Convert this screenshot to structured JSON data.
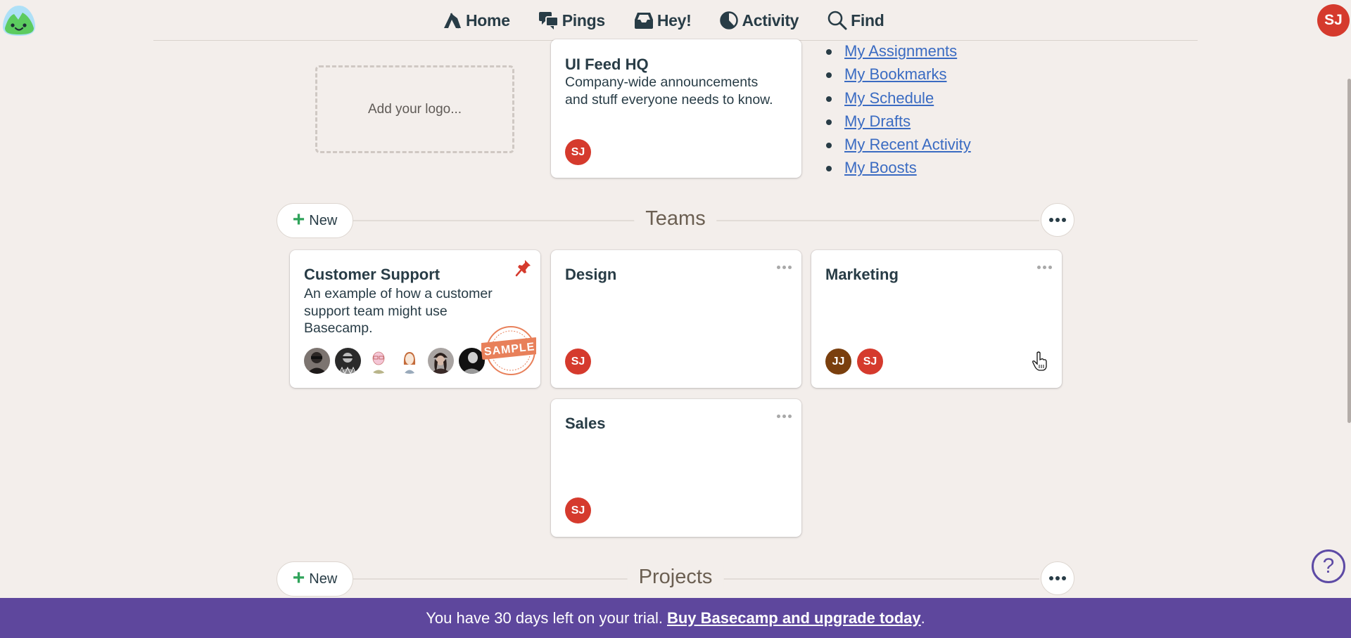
{
  "nav": {
    "items": [
      {
        "label": "Home",
        "icon": "home-icon"
      },
      {
        "label": "Pings",
        "icon": "pings-icon"
      },
      {
        "label": "Hey!",
        "icon": "inbox-icon"
      },
      {
        "label": "Activity",
        "icon": "activity-icon"
      },
      {
        "label": "Find",
        "icon": "search-icon"
      }
    ],
    "user_initials": "SJ"
  },
  "hq": {
    "logo_placeholder": "Add your logo...",
    "card": {
      "title": "UI Feed HQ",
      "description": "Company-wide announcements and stuff everyone needs to know.",
      "members": [
        "SJ"
      ]
    }
  },
  "my_links": [
    "My Assignments",
    "My Bookmarks",
    "My Schedule",
    "My Drafts",
    "My Recent Activity",
    "My Boosts"
  ],
  "teams": {
    "title": "Teams",
    "new_label": "New",
    "cards": [
      {
        "title": "Customer Support",
        "description": "An example of how a customer support team might use Basecamp.",
        "pinned": true,
        "badge": "SAMPLE",
        "member_count": 6
      },
      {
        "title": "Design",
        "members": [
          "SJ"
        ]
      },
      {
        "title": "Marketing",
        "members": [
          "JJ",
          "SJ"
        ]
      },
      {
        "title": "Sales",
        "members": [
          "SJ"
        ]
      }
    ]
  },
  "projects": {
    "title": "Projects",
    "new_label": "New"
  },
  "trial": {
    "message": "You have 30 days left on your trial.",
    "link": "Buy Basecamp and upgrade today",
    "suffix": "."
  },
  "help": {
    "label": "?"
  },
  "colors": {
    "accent_purple": "#5e479d",
    "avatar_red": "#d53a2d",
    "avatar_brown": "#7a3f0e",
    "link_blue": "#3a6bc2",
    "plus_green": "#2fa35a"
  }
}
